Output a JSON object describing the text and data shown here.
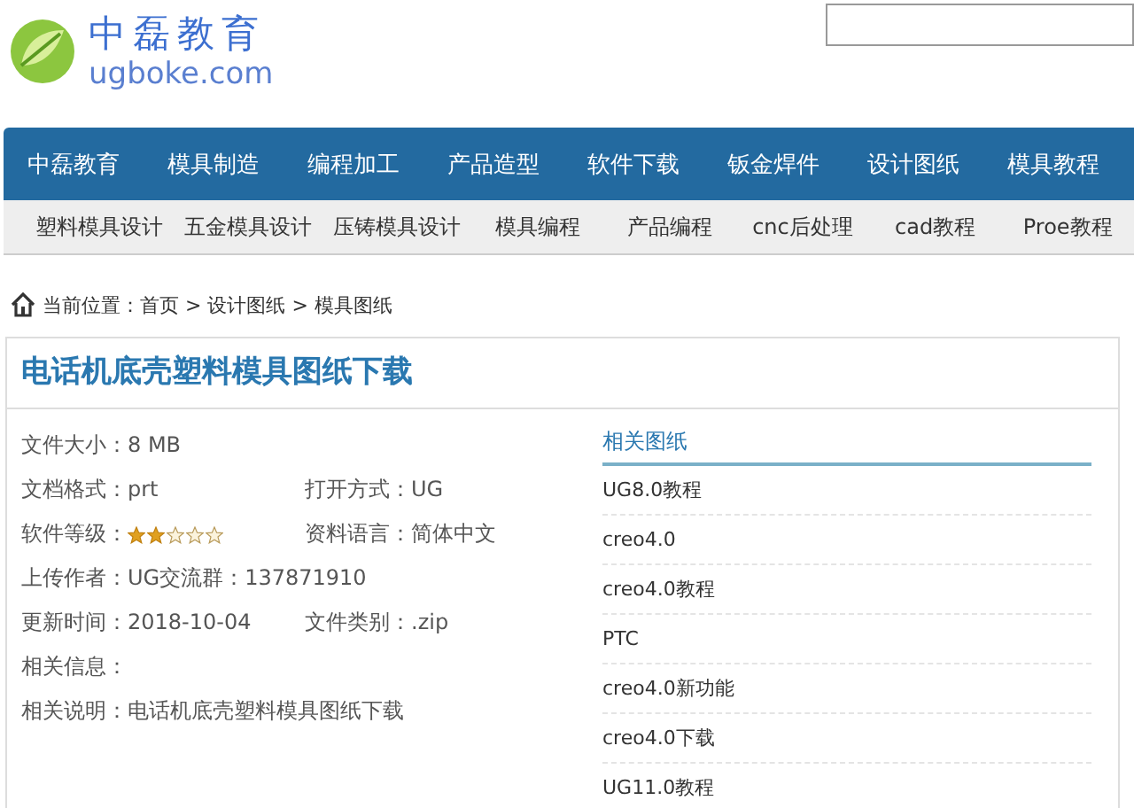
{
  "logo": {
    "name": "中磊教育",
    "domain": "ugboke.com"
  },
  "nav": [
    "中磊教育",
    "模具制造",
    "编程加工",
    "产品造型",
    "软件下载",
    "钣金焊件",
    "设计图纸",
    "模具教程"
  ],
  "subnav": [
    "塑料模具设计",
    "五金模具设计",
    "压铸模具设计",
    "模具编程",
    "产品编程",
    "cnc后处理",
    "cad教程",
    "Proe教程"
  ],
  "breadcrumb": "当前位置：首页 > 设计图纸 > 模具图纸",
  "title": "电话机底壳塑料模具图纸下载",
  "info_rows": [
    [
      {
        "kind": "text",
        "label": "文件大小：",
        "value": "8 MB"
      }
    ],
    [
      {
        "kind": "text",
        "label": "文档格式：",
        "value": "prt"
      },
      {
        "kind": "text",
        "label": "打开方式：",
        "value": "UG"
      }
    ],
    [
      {
        "kind": "stars",
        "label": "软件等级：",
        "stars": 2
      },
      {
        "kind": "text",
        "label": "资料语言：",
        "value": "简体中文"
      }
    ],
    [
      {
        "kind": "text",
        "label": "上传作者：",
        "value": "UG交流群：137871910"
      }
    ],
    [
      {
        "kind": "text",
        "label": "更新时间：",
        "value": "2018-10-04"
      },
      {
        "kind": "text",
        "label": "文件类别：",
        "value": ".zip"
      }
    ],
    [
      {
        "kind": "text",
        "label": "相关信息："
      }
    ],
    [
      {
        "kind": "text",
        "label": "相关说明：",
        "value": "电话机底壳塑料模具图纸下载"
      }
    ]
  ],
  "related": {
    "heading": "相关图纸",
    "items": [
      "UG8.0教程",
      "creo4.0",
      "creo4.0教程",
      "PTC",
      "creo4.0新功能",
      "creo4.0下载",
      "UG11.0教程"
    ]
  }
}
